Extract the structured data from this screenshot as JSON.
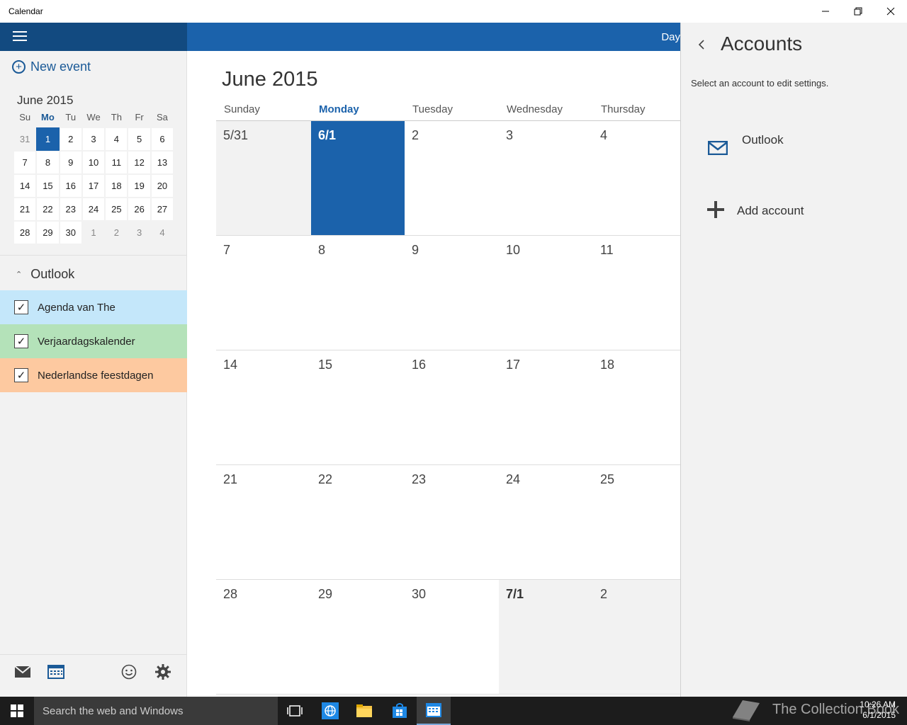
{
  "window": {
    "title": "Calendar"
  },
  "left": {
    "new_event_label": "New event",
    "mini_month_title": "June 2015",
    "mini_dow": [
      "Su",
      "Mo",
      "Tu",
      "We",
      "Th",
      "Fr",
      "Sa"
    ],
    "mini_days": [
      [
        "31",
        "1",
        "2",
        "3",
        "4",
        "5",
        "6"
      ],
      [
        "7",
        "8",
        "9",
        "10",
        "11",
        "12",
        "13"
      ],
      [
        "14",
        "15",
        "16",
        "17",
        "18",
        "19",
        "20"
      ],
      [
        "21",
        "22",
        "23",
        "24",
        "25",
        "26",
        "27"
      ],
      [
        "28",
        "29",
        "30",
        "1",
        "2",
        "3",
        "4"
      ]
    ],
    "group_label": "Outlook",
    "calendars": [
      {
        "label": "Agenda van The",
        "color": "#c4e7fa"
      },
      {
        "label": "Verjaardagskalender",
        "color": "#b4e2b9"
      },
      {
        "label": "Nederlandse feestdagen",
        "color": "#fdc9a0"
      }
    ]
  },
  "topbar": {
    "day_label": "Day"
  },
  "main": {
    "month_title": "June 2015",
    "weekdays": [
      "Sunday",
      "Monday",
      "Tuesday",
      "Wednesday",
      "Thursday"
    ],
    "weeks": [
      [
        "5/31",
        "6/1",
        "2",
        "3",
        "4"
      ],
      [
        "7",
        "8",
        "9",
        "10",
        "11"
      ],
      [
        "14",
        "15",
        "16",
        "17",
        "18"
      ],
      [
        "21",
        "22",
        "23",
        "24",
        "25"
      ],
      [
        "28",
        "29",
        "30",
        "7/1",
        "2"
      ]
    ]
  },
  "flyout": {
    "title": "Accounts",
    "subtitle": "Select an account to edit settings.",
    "accounts": [
      {
        "label": "Outlook",
        "icon": "mail-icon"
      }
    ],
    "add_account_label": "Add account"
  },
  "taskbar": {
    "search_placeholder": "Search the web and Windows",
    "time": "10:26 AM",
    "date": "6/1/2015",
    "watermark": "The Collection Book"
  },
  "colors": {
    "accent": "#1b62ab",
    "accent_dark": "#124a80"
  }
}
